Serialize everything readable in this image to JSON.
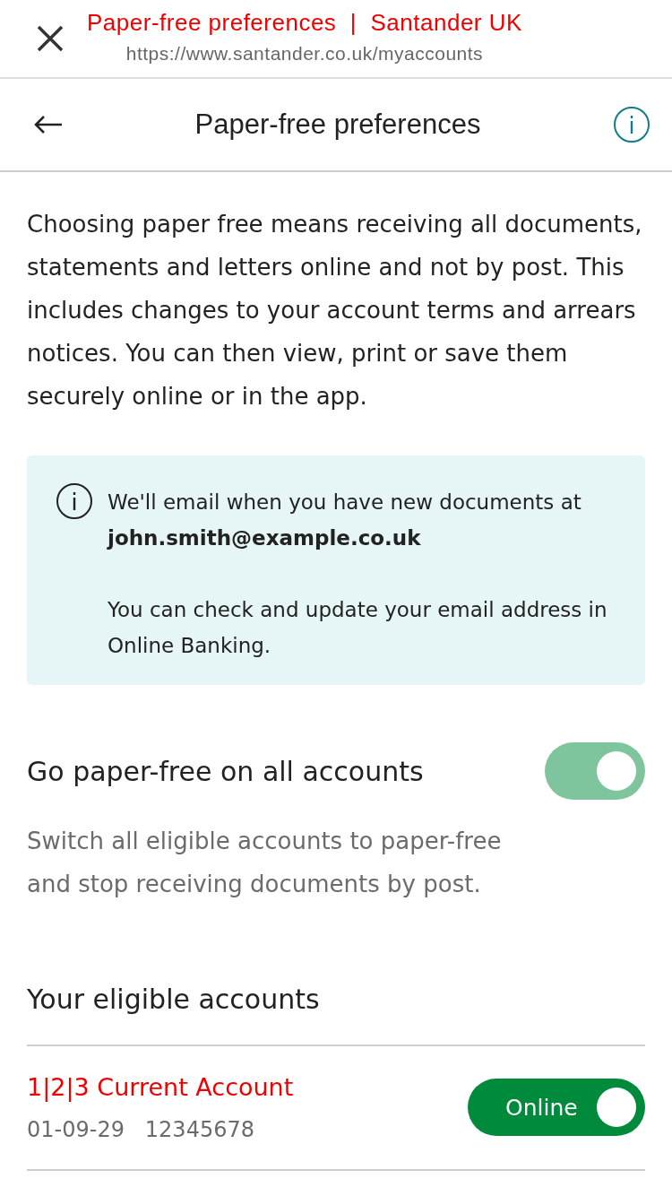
{
  "browser_bar": {
    "title": "Paper-free preferences  |  Santander UK",
    "url": "https://www.santander.co.uk/myaccounts"
  },
  "header": {
    "title": "Paper-free preferences"
  },
  "intro": "Choosing paper free means receiving all documents, statements and letters online and not by post. This includes changes to your account terms and arrears notices. You can then view, print or save them securely online or in the app.",
  "info_box": {
    "lines": [
      "We'll email when you have new documents at **john.smith@example.co.uk**",
      "You can check and update your email address in Online Banking."
    ]
  },
  "all_accounts": {
    "label": "Go paper-free on all accounts",
    "on": true,
    "disabled": true,
    "description": "Switch all eligible accounts to paper-free and stop receiving documents by post."
  },
  "accounts_heading": "Your eligible accounts",
  "accounts": [
    {
      "name": "1|2|3 Current Account",
      "sort_code": "01-09-29",
      "number": "12345678",
      "toggle_label": "Online",
      "on": true
    }
  ]
}
